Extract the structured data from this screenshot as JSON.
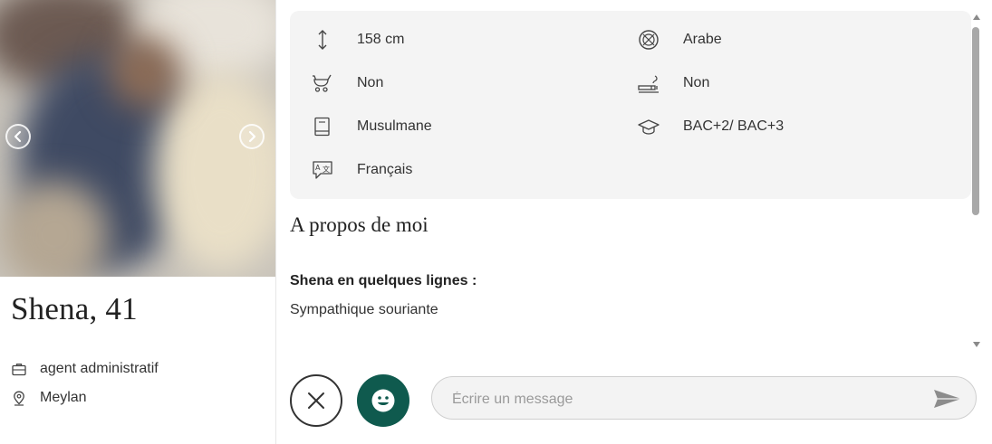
{
  "profile": {
    "name": "Shena, 41",
    "job": "agent administratif",
    "job_icon": "briefcase-icon",
    "city": "Meylan",
    "city_icon": "location-pin-icon"
  },
  "facts": {
    "height": {
      "icon": "height-arrows-icon",
      "value": "158 cm"
    },
    "origin": {
      "icon": "globe-icon",
      "value": "Arabe"
    },
    "children": {
      "icon": "stroller-icon",
      "value": "Non"
    },
    "smoker": {
      "icon": "cigarette-icon",
      "value": "Non"
    },
    "religion": {
      "icon": "book-icon",
      "value": "Musulmane"
    },
    "education": {
      "icon": "graduation-cap-icon",
      "value": "BAC+2/ BAC+3"
    },
    "language": {
      "icon": "translate-icon",
      "value": "Français"
    }
  },
  "about": {
    "title": "A propos de moi",
    "subtitle": "Shena en quelques lignes :",
    "text": "Sympathique souriante"
  },
  "message": {
    "placeholder": "Écrire un message"
  },
  "colors": {
    "accent": "#0f5a4e",
    "facts_background": "#f4f4f4"
  }
}
